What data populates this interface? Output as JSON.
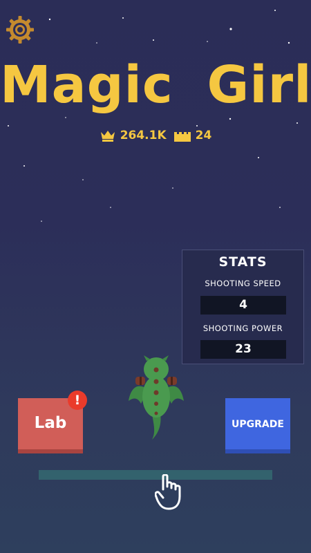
{
  "game": {
    "title": "Magic  Girl",
    "crown_score": "264.1K",
    "castle_level": "24"
  },
  "stats": {
    "heading": "STATS",
    "shooting_speed_label": "SHOOTING SPEED",
    "shooting_speed_value": "4",
    "shooting_power_label": "SHOOTING POWER",
    "shooting_power_value": "23"
  },
  "buttons": {
    "lab_label": "Lab",
    "lab_alert": "!",
    "upgrade_label": "UPGRADE"
  },
  "icons": {
    "settings": "gear-icon",
    "score": "crown-icon",
    "level": "castle-icon",
    "tutorial": "hand-pointer-icon",
    "character": "dragon-sprite"
  },
  "colors": {
    "title": "#f5c741",
    "lab_button": "#d15e58",
    "upgrade_button": "#3f66e0",
    "alert": "#ea3b2b",
    "background": "#2c2e59"
  }
}
